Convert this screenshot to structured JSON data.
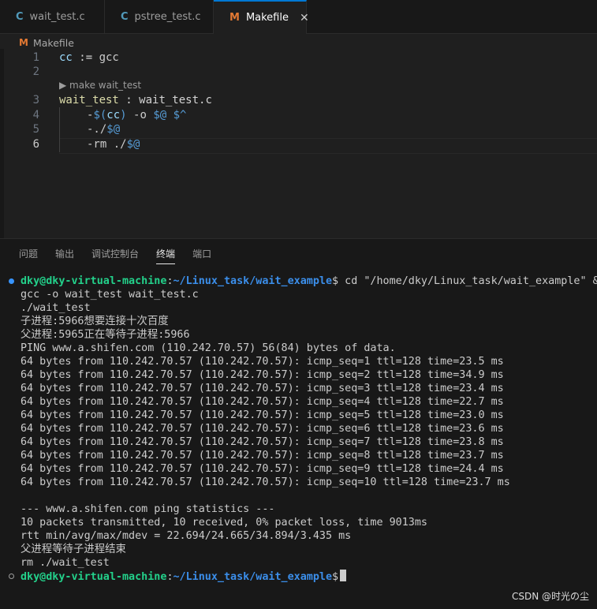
{
  "tabs": [
    {
      "icon": "C",
      "label": "wait_test.c",
      "state": "normal"
    },
    {
      "icon": "C",
      "label": "pstree_test.c",
      "state": "modified"
    },
    {
      "icon": "M",
      "label": "Makefile",
      "state": "active",
      "close": "✕"
    }
  ],
  "breadcrumb": {
    "icon": "M",
    "label": "Makefile"
  },
  "editor": {
    "line_numbers": [
      "1",
      "2",
      "3",
      "4",
      "5",
      "6"
    ],
    "codelens": "▶ make wait_test",
    "lines": {
      "l1_a": "cc",
      "l1_b": " := ",
      "l1_c": "gcc",
      "l3_a": "wait_test",
      "l3_b": " : ",
      "l3_c": "wait_test.c",
      "l4_a": "-",
      "l4_b": "$(",
      "l4_c": "cc",
      "l4_d": ")",
      "l4_e": " -o ",
      "l4_f": "$@",
      "l4_g": " ",
      "l4_h": "$^",
      "l5_a": "-./",
      "l5_b": "$@",
      "l6_a": "-rm ./",
      "l6_b": "$@"
    }
  },
  "panel": {
    "tabs": [
      "问题",
      "输出",
      "调试控制台",
      "终端",
      "端口"
    ],
    "active_tab": "终端"
  },
  "terminal": {
    "prompt_user": "dky@dky-virtual-machine",
    "prompt_sep": ":",
    "prompt_path": "~/Linux_task/wait_example",
    "prompt_end": "$",
    "first_command": " cd \"/home/dky/Linux_task/wait_example\" &&",
    "output": [
      "gcc -o wait_test wait_test.c",
      "./wait_test",
      "子进程:5966想要连接十次百度",
      "父进程:5965正在等待子进程:5966",
      "PING www.a.shifen.com (110.242.70.57) 56(84) bytes of data.",
      "64 bytes from 110.242.70.57 (110.242.70.57): icmp_seq=1 ttl=128 time=23.5 ms",
      "64 bytes from 110.242.70.57 (110.242.70.57): icmp_seq=2 ttl=128 time=34.9 ms",
      "64 bytes from 110.242.70.57 (110.242.70.57): icmp_seq=3 ttl=128 time=23.4 ms",
      "64 bytes from 110.242.70.57 (110.242.70.57): icmp_seq=4 ttl=128 time=22.7 ms",
      "64 bytes from 110.242.70.57 (110.242.70.57): icmp_seq=5 ttl=128 time=23.0 ms",
      "64 bytes from 110.242.70.57 (110.242.70.57): icmp_seq=6 ttl=128 time=23.6 ms",
      "64 bytes from 110.242.70.57 (110.242.70.57): icmp_seq=7 ttl=128 time=23.8 ms",
      "64 bytes from 110.242.70.57 (110.242.70.57): icmp_seq=8 ttl=128 time=23.7 ms",
      "64 bytes from 110.242.70.57 (110.242.70.57): icmp_seq=9 ttl=128 time=24.4 ms",
      "64 bytes from 110.242.70.57 (110.242.70.57): icmp_seq=10 ttl=128 time=23.7 ms",
      "",
      "--- www.a.shifen.com ping statistics ---",
      "10 packets transmitted, 10 received, 0% packet loss, time 9013ms",
      "rtt min/avg/max/mdev = 22.694/24.665/34.894/3.435 ms",
      "父进程等待子进程结束",
      "rm ./wait_test"
    ]
  },
  "watermark": "CSDN @时光の尘"
}
